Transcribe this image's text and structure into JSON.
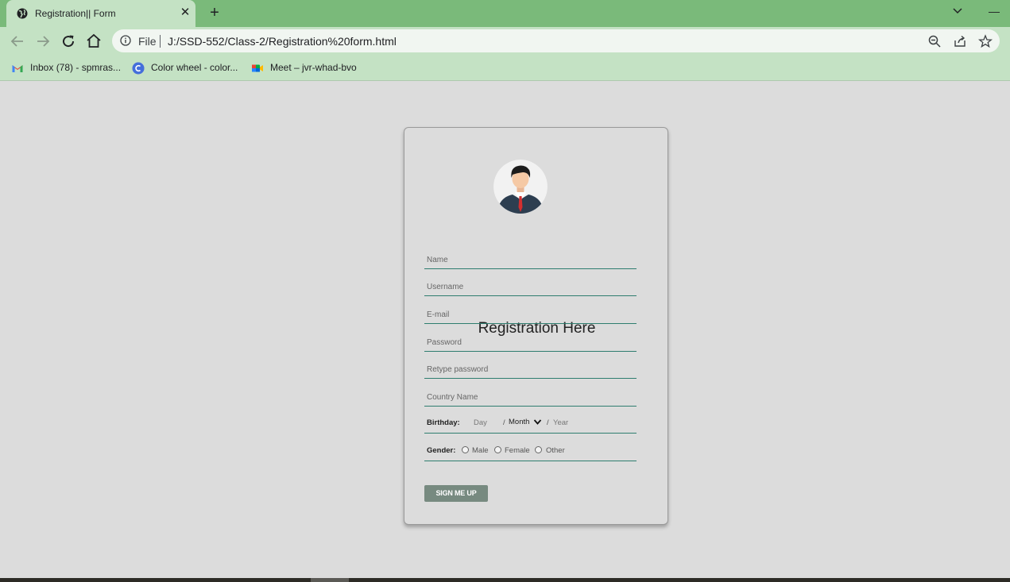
{
  "browser": {
    "tab": {
      "title": "Registration|| Form"
    },
    "address": {
      "scheme": "File",
      "url": "J:/SSD-552/Class-2/Registration%20form.html"
    },
    "bookmarks": [
      {
        "label": "Inbox (78) - spmras...",
        "icon": "gmail-icon"
      },
      {
        "label": "Color wheel - color...",
        "icon": "canva-icon"
      },
      {
        "label": "Meet – jvr-whad-bvo",
        "icon": "meet-icon"
      }
    ]
  },
  "form": {
    "title": "Registration Here",
    "fields": {
      "name": "Name",
      "username": "Username",
      "email": "E-mail",
      "password": "Password",
      "retype_password": "Retype password",
      "country": "Country Name"
    },
    "birthday": {
      "label": "Birthday:",
      "day": "Day",
      "month": "Month",
      "year": "Year",
      "separator": "/"
    },
    "gender": {
      "label": "Gender:",
      "options": [
        "Male",
        "Female",
        "Other"
      ]
    },
    "submit": "SIGN ME UP"
  },
  "colors": {
    "tab_strip": "#7aba7a",
    "toolbar": "#c4e2c4",
    "page_bg": "#dcdcdc",
    "field_underline": "#2e7d6f",
    "button_bg": "#778a80"
  }
}
